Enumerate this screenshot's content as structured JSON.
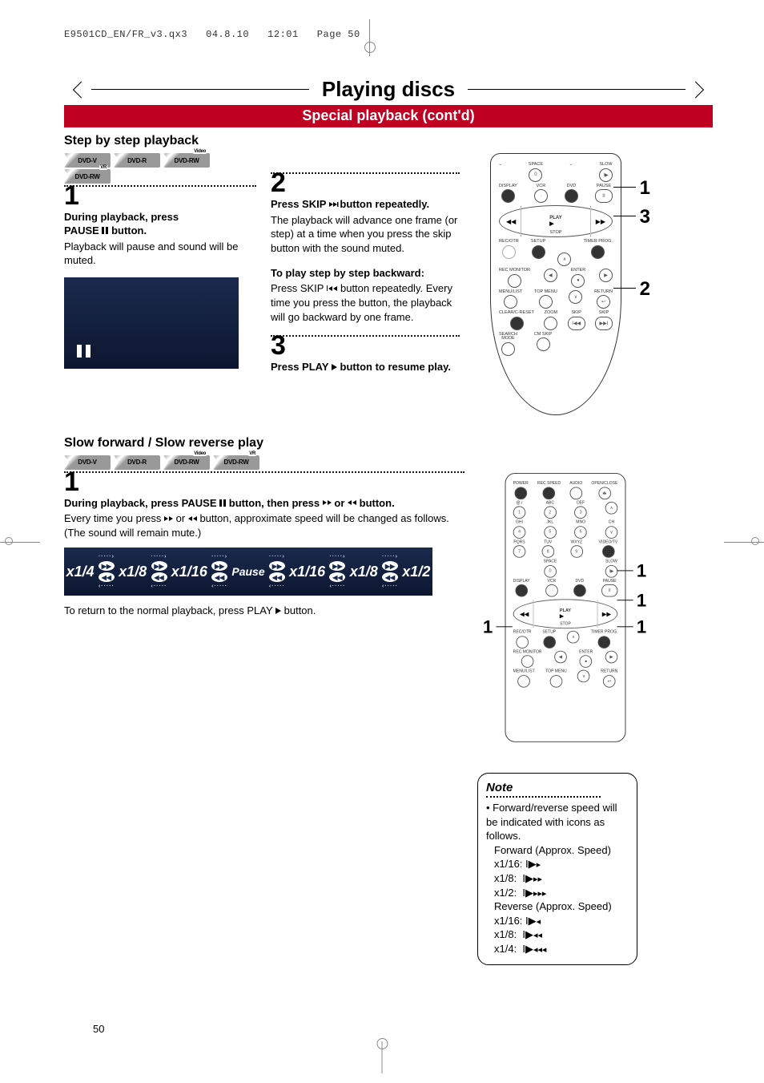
{
  "meta": {
    "file": "E9501CD_EN/FR_v3.qx3",
    "date": "04.8.10",
    "time": "12:01",
    "pagehead": "Page 50"
  },
  "title": "Playing discs",
  "subtitle": "Special playback (cont'd)",
  "section1": {
    "heading": "Step by step playback",
    "badges": [
      "DVD-V",
      "DVD-R",
      "DVD-RW",
      "DVD-RW"
    ],
    "badges_sup": [
      "",
      "",
      "Video",
      "VR"
    ],
    "step1": {
      "num": "1",
      "bold_a": "During playback, press",
      "bold_b": "PAUSE",
      "bold_c": "button.",
      "text": "Playback will pause and sound will be muted."
    },
    "step2": {
      "num": "2",
      "bold_a": "Press SKIP",
      "bold_b": "button repeatedly.",
      "text": "The playback will advance one frame (or step) at a time when you press the skip button with the sound muted.",
      "back_bold": "To play step by step backward:",
      "back_a": "Press SKIP",
      "back_b": "button repeatedly. Every time you press the button, the playback will go backward by one frame."
    },
    "step3": {
      "num": "3",
      "bold_a": "Press PLAY",
      "bold_b": "button to resume play."
    },
    "callouts": {
      "c1": "1",
      "c2": "2",
      "c3": "3"
    }
  },
  "section2": {
    "heading": "Slow forward / Slow reverse play",
    "badges": [
      "DVD-V",
      "DVD-R",
      "DVD-RW",
      "DVD-RW"
    ],
    "badges_sup": [
      "",
      "",
      "Video",
      "VR"
    ],
    "step1": {
      "num": "1",
      "bold_a": "During playback, press PAUSE",
      "bold_b": "button, then press",
      "bold_c": "or",
      "bold_d": "button.",
      "text_a": "Every time you press",
      "text_b": "or",
      "text_c": "button, approximate speed will be changed as follows. (The sound will remain mute.)",
      "resume_a": "To return to the normal playback, press PLAY",
      "resume_b": "button."
    },
    "speeds": [
      "x1/4",
      "x1/8",
      "x1/16",
      "Pause",
      "x1/16",
      "x1/8",
      "x1/2"
    ],
    "callout": "1",
    "note": {
      "title": "Note",
      "intro": "Forward/reverse speed will be indicated with icons as follows.",
      "fwd_head": "Forward (Approx. Speed)",
      "fwd": [
        "x1/16:",
        "x1/8:",
        "x1/2:"
      ],
      "rev_head": "Reverse (Approx. Speed)",
      "rev": [
        "x1/16:",
        "x1/8:",
        "x1/4:"
      ]
    }
  },
  "remote_labels": {
    "space": "SPACE",
    "slow": "SLOW",
    "display": "DISPLAY",
    "vcr": "VCR",
    "dvd": "DVD",
    "pause": "PAUSE",
    "play": "PLAY",
    "stop": "STOP",
    "recotr": "REC/OTR",
    "setup": "SETUP",
    "timerprog": "TIMER PROG.",
    "recmonitor": "REC MONITOR",
    "enter": "ENTER",
    "menulist": "MENU/LIST",
    "topmenu": "TOP MENU",
    "return": "RETURN",
    "clearcreset": "CLEAR/C-RESET",
    "zoom": "ZOOM",
    "skip": "SKIP",
    "search": "SEARCH",
    "mode": "MODE",
    "cmskip": "CM SKIP",
    "power": "POWER",
    "recspeed": "REC SPEED",
    "audio": "AUDIO",
    "openclose": "OPEN/CLOSE",
    "abc": "ABC",
    "def": "DEF",
    "ghi": "GHI",
    "jkl": "JKL",
    "mno": "MNO",
    "ch_label": "CH",
    "pqrs": "PQRS",
    "tuv": "TUV",
    "wxyz": "WXYZ",
    "videotv": "VIDEO/TV",
    "n0": "0",
    "n1": "1",
    "n2": "2",
    "n3": "3",
    "n4": "4",
    "n5": "5",
    "n6": "6",
    "n7": "7",
    "n8": "8",
    "n9": "9",
    "ch_up": "∧",
    "ch_dn": "∨",
    "rew": "◀◀",
    "fwd": "▶▶"
  },
  "page_number": "50"
}
